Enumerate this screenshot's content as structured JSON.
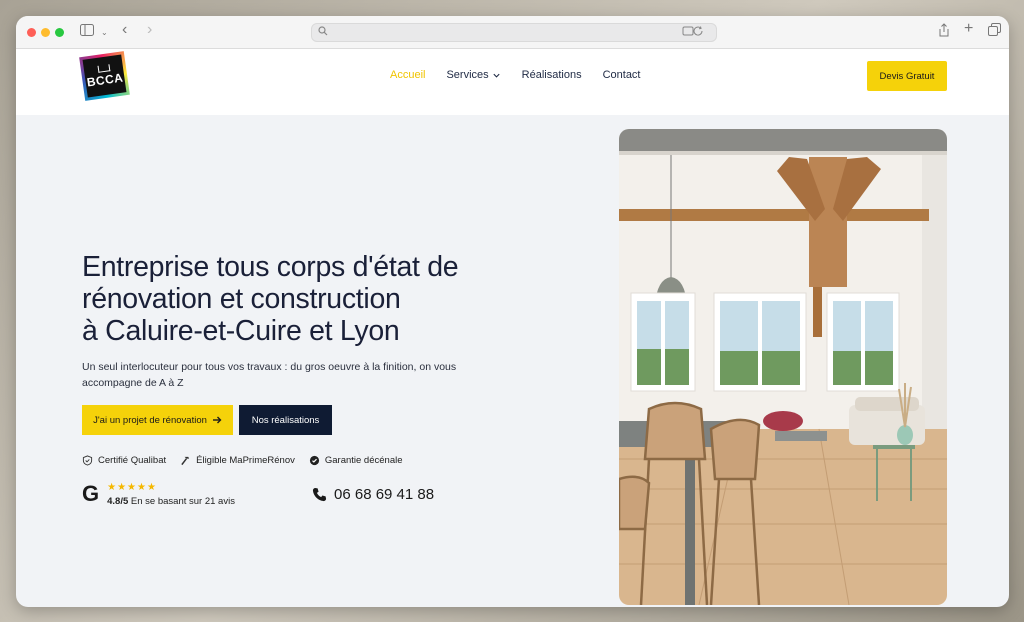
{
  "site": {
    "logo_text": "BCCA",
    "nav": [
      {
        "label": "Accueil",
        "active": true
      },
      {
        "label": "Services",
        "active": false,
        "has_dropdown": true
      },
      {
        "label": "Réalisations",
        "active": false
      },
      {
        "label": "Contact",
        "active": false
      }
    ],
    "cta_label": "Devis Gratuit"
  },
  "hero": {
    "title_lines": [
      "Entreprise tous corps d'état de",
      "rénovation et construction",
      "à Caluire-et-Cuire et Lyon"
    ],
    "subtitle": "Un seul interlocuteur pour tous vos travaux : du gros oeuvre à la finition, on vous accompagne de A à Z",
    "primary_button": "J'ai un projet de rénovation",
    "secondary_button": "Nos réalisations",
    "badges": [
      "Certifié Qualibat",
      "Éligible MaPrimeRénov",
      "Garantie décénale"
    ],
    "rating": {
      "score": "4.8/5",
      "text": "En se basant sur 21 avis",
      "stars": "★★★★★"
    },
    "phone": "06 68 69 41 88"
  },
  "colors": {
    "accent": "#f5d20a",
    "navy": "#0f1b33",
    "nav_active": "#f0c400",
    "background": "#f1f3f6"
  }
}
